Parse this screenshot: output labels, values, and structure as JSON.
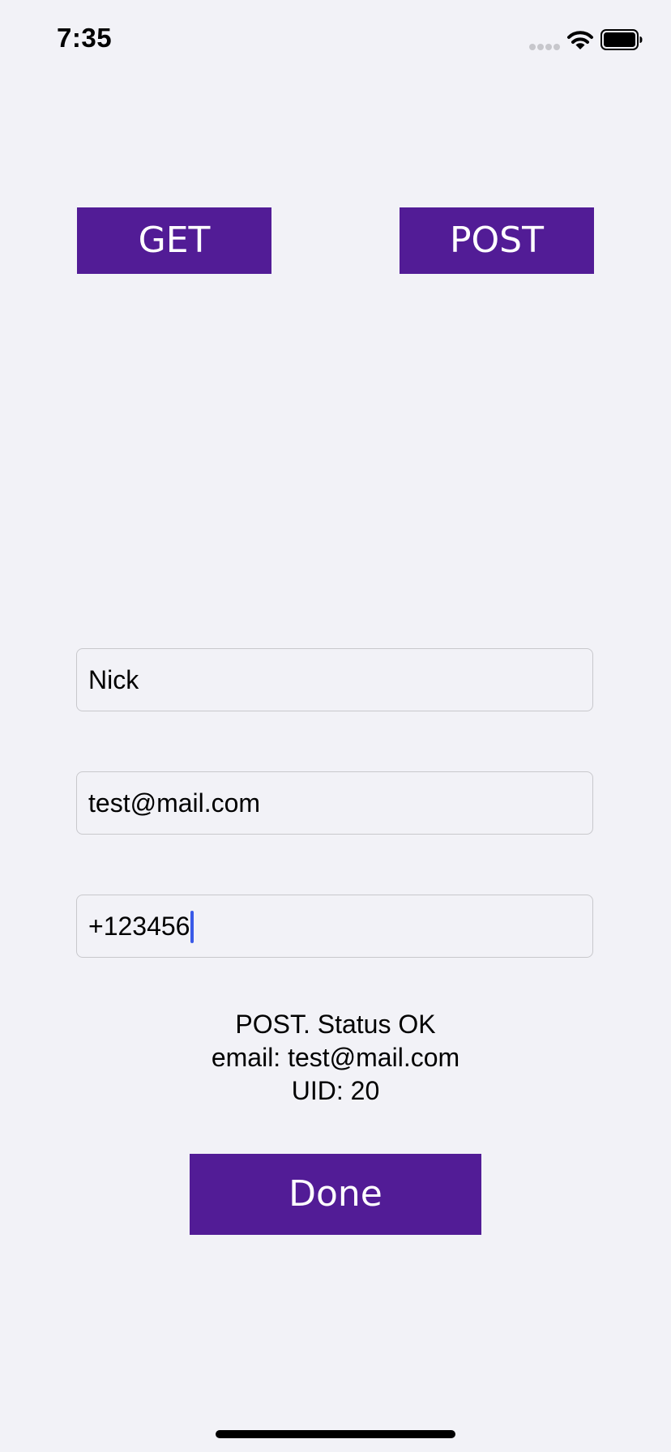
{
  "status_bar": {
    "time": "7:35",
    "icons": [
      "signal-icon",
      "wifi-icon",
      "battery-icon"
    ]
  },
  "buttons": {
    "get_label": "GET",
    "post_label": "POST",
    "done_label": "Done"
  },
  "form": {
    "name_value": "Nick",
    "email_value": "test@mail.com",
    "phone_value": "+123456"
  },
  "result": {
    "line1": "POST. Status OK",
    "line2": "email: test@mail.com",
    "line3": "UID: 20"
  },
  "colors": {
    "button_background": "#521c96",
    "button_text": "#ffffff",
    "page_background": "#f2f2f7",
    "caret": "#3a5ae8"
  }
}
